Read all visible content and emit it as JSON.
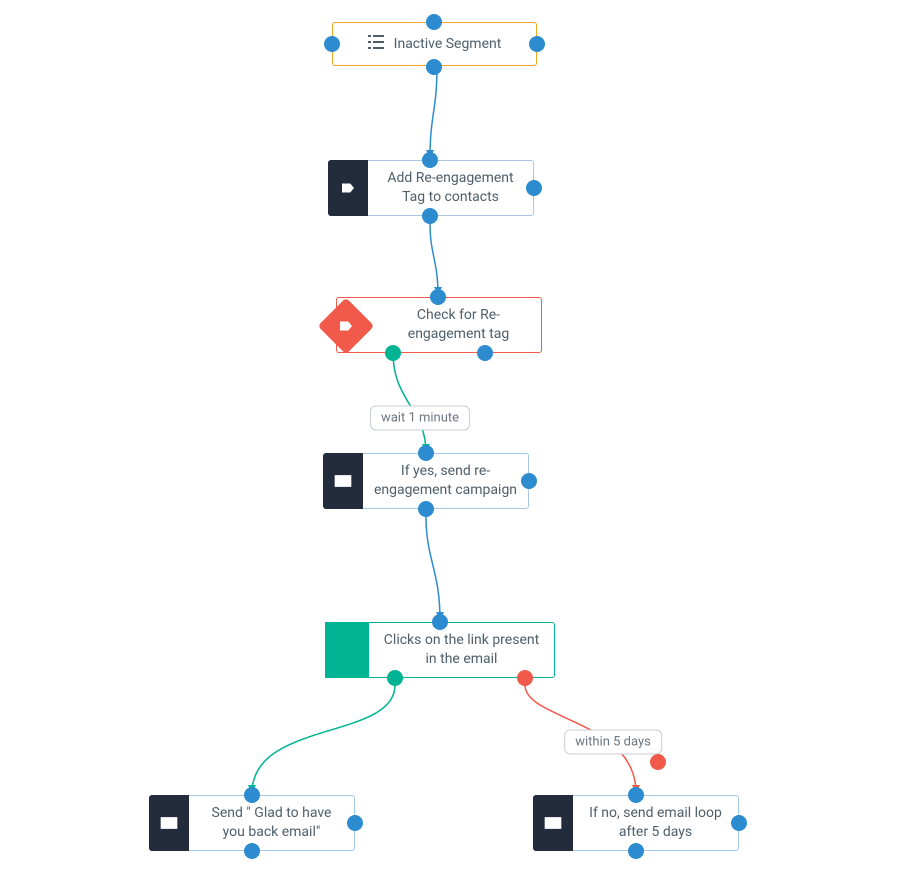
{
  "nodes": {
    "start": {
      "label": "Inactive Segment"
    },
    "addTag": {
      "label": "Add Re-engagement Tag to contacts"
    },
    "checkTag": {
      "label": "Check for Re-engagement tag"
    },
    "sendReeng": {
      "label": "If yes, send re-engagement campaign"
    },
    "clicksLink": {
      "label": "Clicks on the link present in the email"
    },
    "gladBack": {
      "label": "Send \" Glad to have you back email\""
    },
    "loop5days": {
      "label": "If no, send email loop after 5 days"
    }
  },
  "pills": {
    "wait1min": "wait 1 minute",
    "within5": "within 5 days"
  },
  "colors": {
    "blue": "#2d8ccf",
    "teal": "#00b393",
    "red": "#f15a4a",
    "orange": "#f5a623",
    "darkBox": "#232c3d"
  }
}
